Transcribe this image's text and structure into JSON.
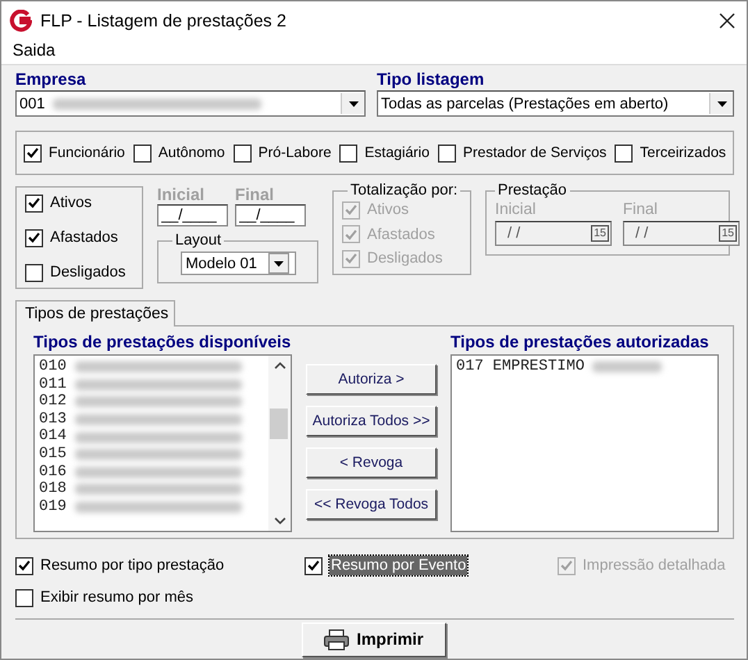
{
  "window": {
    "title": "FLP - Listagem de prestações 2"
  },
  "menu": [
    {
      "label": "Saida"
    }
  ],
  "empresa": {
    "label": "Empresa",
    "value": "001",
    "redacted": true
  },
  "tipo_listagem": {
    "label": "Tipo listagem",
    "value": "Todas as parcelas  (Prestações em aberto)"
  },
  "categories": [
    {
      "label": "Funcionário",
      "checked": true
    },
    {
      "label": "Autônomo",
      "checked": false
    },
    {
      "label": "Pró-Labore",
      "checked": false
    },
    {
      "label": "Estagiário",
      "checked": false
    },
    {
      "label": "Prestador de Serviços",
      "checked": false
    },
    {
      "label": "Terceirizados",
      "checked": false
    }
  ],
  "status": [
    {
      "label": "Ativos",
      "checked": true
    },
    {
      "label": "Afastados",
      "checked": true
    },
    {
      "label": "Desligados",
      "checked": false
    }
  ],
  "period": [
    {
      "label": "Inicial",
      "value": "__/____"
    },
    {
      "label": "Final",
      "value": "__/____"
    }
  ],
  "layout": {
    "title": "Layout",
    "value": "Modelo 01"
  },
  "totalizacao": {
    "title": "Totalização por:",
    "items": [
      {
        "label": "Ativos",
        "checked": true,
        "disabled": true
      },
      {
        "label": "Afastados",
        "checked": true,
        "disabled": true
      },
      {
        "label": "Desligados",
        "checked": true,
        "disabled": true
      }
    ]
  },
  "prestacao": {
    "title": "Prestação",
    "disabled": true,
    "fields": [
      {
        "label": "Inicial",
        "value": "/ /",
        "calendar": "15"
      },
      {
        "label": "Final",
        "value": "/ /",
        "calendar": "15"
      }
    ]
  },
  "tabs": [
    {
      "label": "Tipos de prestações",
      "selected": true
    }
  ],
  "available": {
    "title": "Tipos de prestações disponíveis",
    "items": [
      {
        "text": "010",
        "redacted": true
      },
      {
        "text": "011",
        "redacted": true
      },
      {
        "text": "012",
        "redacted": true
      },
      {
        "text": "013",
        "redacted": true
      },
      {
        "text": "014",
        "redacted": true
      },
      {
        "text": "015",
        "redacted": true
      },
      {
        "text": "016",
        "redacted": true
      },
      {
        "text": "018",
        "redacted": true
      },
      {
        "text": "019",
        "redacted": true
      }
    ]
  },
  "actions": [
    {
      "label": "Autoriza >"
    },
    {
      "label": "Autoriza Todos >>"
    },
    {
      "label": "< Revoga"
    },
    {
      "label": "<< Revoga Todos"
    }
  ],
  "authorized": {
    "title": "Tipos de prestações autorizadas",
    "items": [
      {
        "text": "017 EMPRESTIMO",
        "redacted": true
      }
    ]
  },
  "options": [
    {
      "label": "Resumo por tipo prestação",
      "checked": true,
      "disabled": false,
      "focused": false
    },
    {
      "label": "Resumo por Evento",
      "checked": true,
      "disabled": false,
      "focused": true
    },
    {
      "label": "Impressão detalhada",
      "checked": true,
      "disabled": true,
      "focused": false
    },
    {
      "label": "Exibir resumo por mês",
      "checked": false,
      "disabled": false,
      "focused": false
    }
  ],
  "print_button": {
    "label": "Imprimir"
  }
}
